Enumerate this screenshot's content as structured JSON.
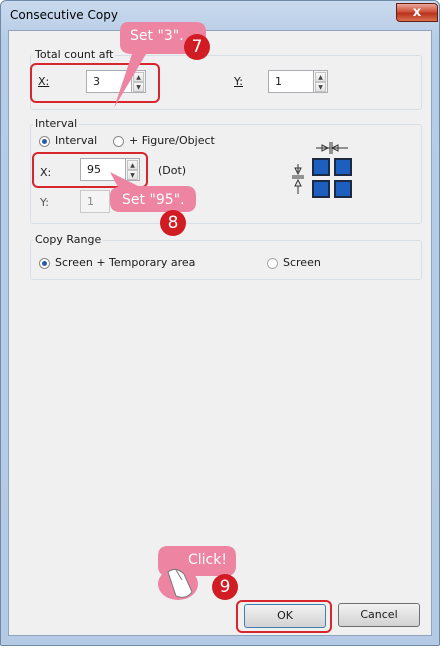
{
  "window": {
    "title": "Consecutive Copy",
    "close_glyph": "x"
  },
  "total_count": {
    "legend": "Total count aft",
    "x_label": "X:",
    "x_value": "3",
    "y_label": "Y:",
    "y_value": "1"
  },
  "interval": {
    "legend": "Interval",
    "radio_interval": "Interval",
    "radio_figure": "+ Figure/Object",
    "x_label": "X:",
    "x_value": "95",
    "x_unit": "(Dot)",
    "y_label": "Y:",
    "y_value": "1"
  },
  "copy_range": {
    "legend": "Copy Range",
    "option_screen_temp": "Screen + Temporary area",
    "option_screen": "Screen"
  },
  "buttons": {
    "ok": "OK",
    "cancel": "Cancel"
  },
  "callouts": {
    "step7": {
      "text": "Set \"3\".",
      "number": "7"
    },
    "step8": {
      "text": "Set \"95\".",
      "number": "8"
    },
    "step9": {
      "text": "Click!",
      "number": "9"
    }
  },
  "colors": {
    "accent_red": "#d8262f",
    "callout_pink": "#ec84a2",
    "badge_red": "#d21c24"
  }
}
